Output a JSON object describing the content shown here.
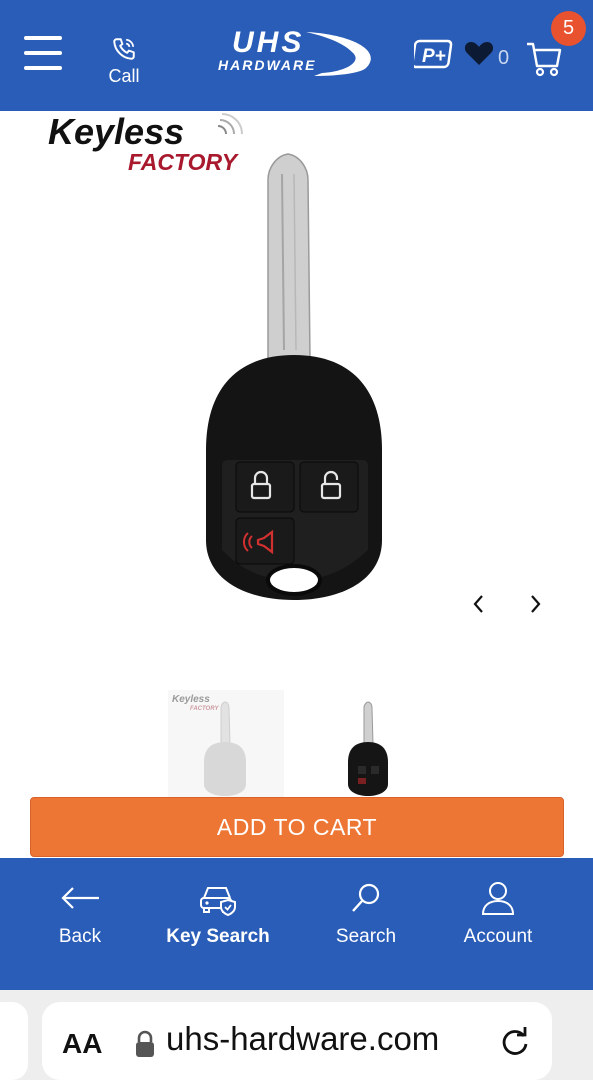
{
  "header": {
    "call_label": "Call",
    "brand": {
      "logo_line1": "UHS",
      "logo_line2": "HARDWARE"
    },
    "pplus_label": "P+",
    "wishlist_count": "0",
    "cart_count": "5"
  },
  "product": {
    "brand_logo": {
      "line1": "Keyless",
      "line2": "FACTORY"
    },
    "add_to_cart_label": "ADD TO CART"
  },
  "bottom_nav": {
    "items": [
      {
        "label": "Back",
        "icon": "arrow-left-icon"
      },
      {
        "label": "Key Search",
        "icon": "car-shield-icon"
      },
      {
        "label": "Search",
        "icon": "search-icon"
      },
      {
        "label": "Account",
        "icon": "user-icon"
      }
    ]
  },
  "browser": {
    "text_size_label": "AA",
    "url": "uhs-hardware.com"
  },
  "colors": {
    "brand_blue": "#2a5db8",
    "cta_orange": "#ee7634",
    "badge_red": "#e8522e"
  }
}
